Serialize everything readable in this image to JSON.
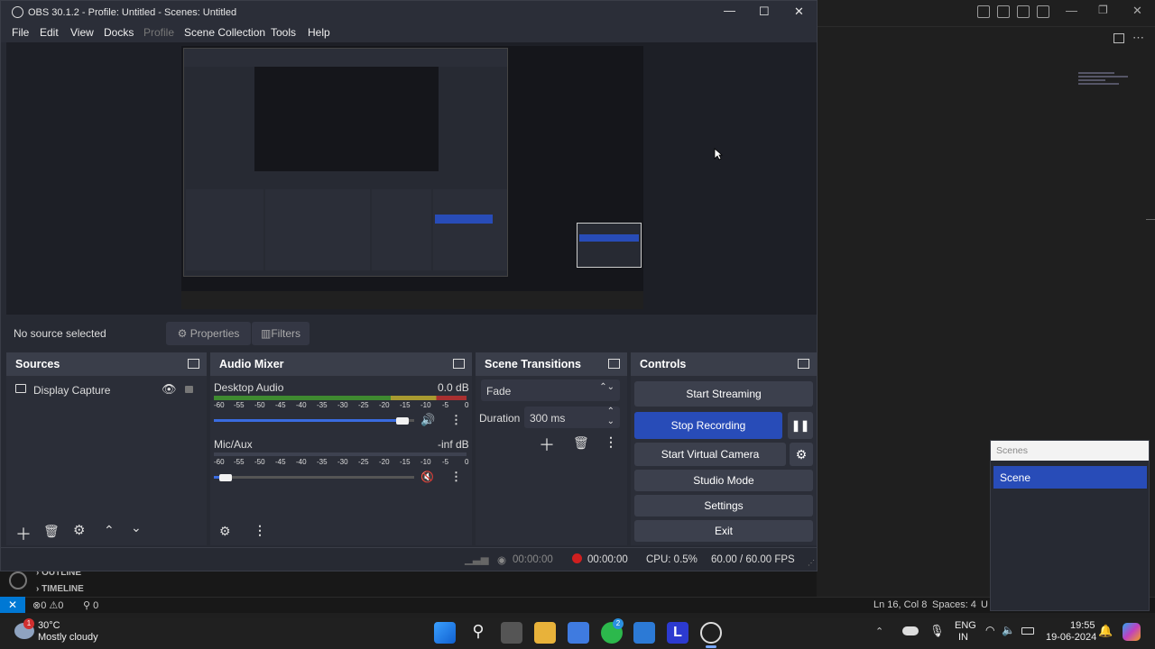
{
  "window": {
    "title": "OBS 30.1.2 - Profile: Untitled - Scenes: Untitled",
    "minimize": "—",
    "maximize": "☐",
    "close": "✕"
  },
  "menu": [
    "File",
    "Edit",
    "View",
    "Docks",
    "Profile",
    "Scene Collection",
    "Tools",
    "Help"
  ],
  "source_toolbar": {
    "no_source": "No source selected",
    "properties": "Properties",
    "filters": "Filters"
  },
  "sources": {
    "title": "Sources",
    "items": [
      {
        "label": "Display Capture"
      }
    ]
  },
  "audio_mixer": {
    "title": "Audio Mixer",
    "scale": [
      "-60",
      "-55",
      "-50",
      "-45",
      "-40",
      "-35",
      "-30",
      "-25",
      "-20",
      "-15",
      "-10",
      "-5",
      "0"
    ],
    "channels": [
      {
        "name": "Desktop Audio",
        "db": "0.0 dB",
        "volume": 0.97
      },
      {
        "name": "Mic/Aux",
        "db": "-inf dB",
        "volume": 0.03
      }
    ]
  },
  "transitions": {
    "title": "Scene Transitions",
    "type": "Fade",
    "duration_label": "Duration",
    "duration_value": "300 ms"
  },
  "controls": {
    "title": "Controls",
    "start_streaming": "Start Streaming",
    "stop_recording": "Stop Recording",
    "start_virtual_camera": "Start Virtual Camera",
    "studio_mode": "Studio Mode",
    "settings": "Settings",
    "exit": "Exit"
  },
  "status": {
    "stream_time": "00:00:00",
    "rec_time": "00:00:00",
    "cpu": "CPU: 0.5%",
    "fps": "60.00 / 60.00 FPS"
  },
  "scenes_dock": {
    "title": "Scenes",
    "items": [
      "Scene"
    ]
  },
  "vscode": {
    "outline": "OUTLINE",
    "timeline": "TIMELINE",
    "errors": "0",
    "warnings": "0",
    "ports": "0",
    "cursor": "Ln 16, Col 8",
    "spaces": "Spaces: 4",
    "encoding_trunc": "U"
  },
  "taskbar": {
    "weather_temp": "30°C",
    "weather_desc": "Mostly cloudy",
    "weather_badge": "1",
    "whatsapp_badge": "2",
    "lang1": "ENG",
    "lang2": "IN",
    "time": "19:55",
    "date": "19-06-2024"
  },
  "colors": {
    "accent": "#284cb8",
    "recording": "#d01f1f",
    "vscode_blue": "#0078d4"
  }
}
